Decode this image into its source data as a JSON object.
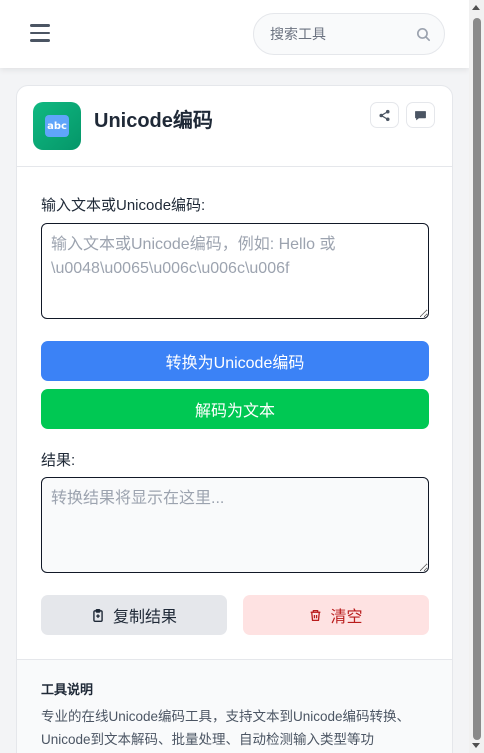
{
  "header": {
    "search_placeholder": "搜索工具"
  },
  "tool": {
    "icon_text": "abc",
    "title": "Unicode编码"
  },
  "input": {
    "label": "输入文本或Unicode编码:",
    "placeholder": "输入文本或Unicode编码，例如: Hello 或 \\u0048\\u0065\\u006c\\u006c\\u006f"
  },
  "buttons": {
    "convert": "转换为Unicode编码",
    "decode": "解码为文本",
    "copy": "复制结果",
    "clear": "清空"
  },
  "result": {
    "label": "结果:",
    "placeholder": "转换结果将显示在这里..."
  },
  "description": {
    "title": "工具说明",
    "text": "专业的在线Unicode编码工具，支持文本到Unicode编码转换、Unicode到文本解码、批量处理、自动检测输入类型等功"
  },
  "colors": {
    "accent_blue": "#3b82f6",
    "accent_green": "#00c853",
    "danger": "#b91c1c",
    "danger_bg": "#fee2e2"
  }
}
